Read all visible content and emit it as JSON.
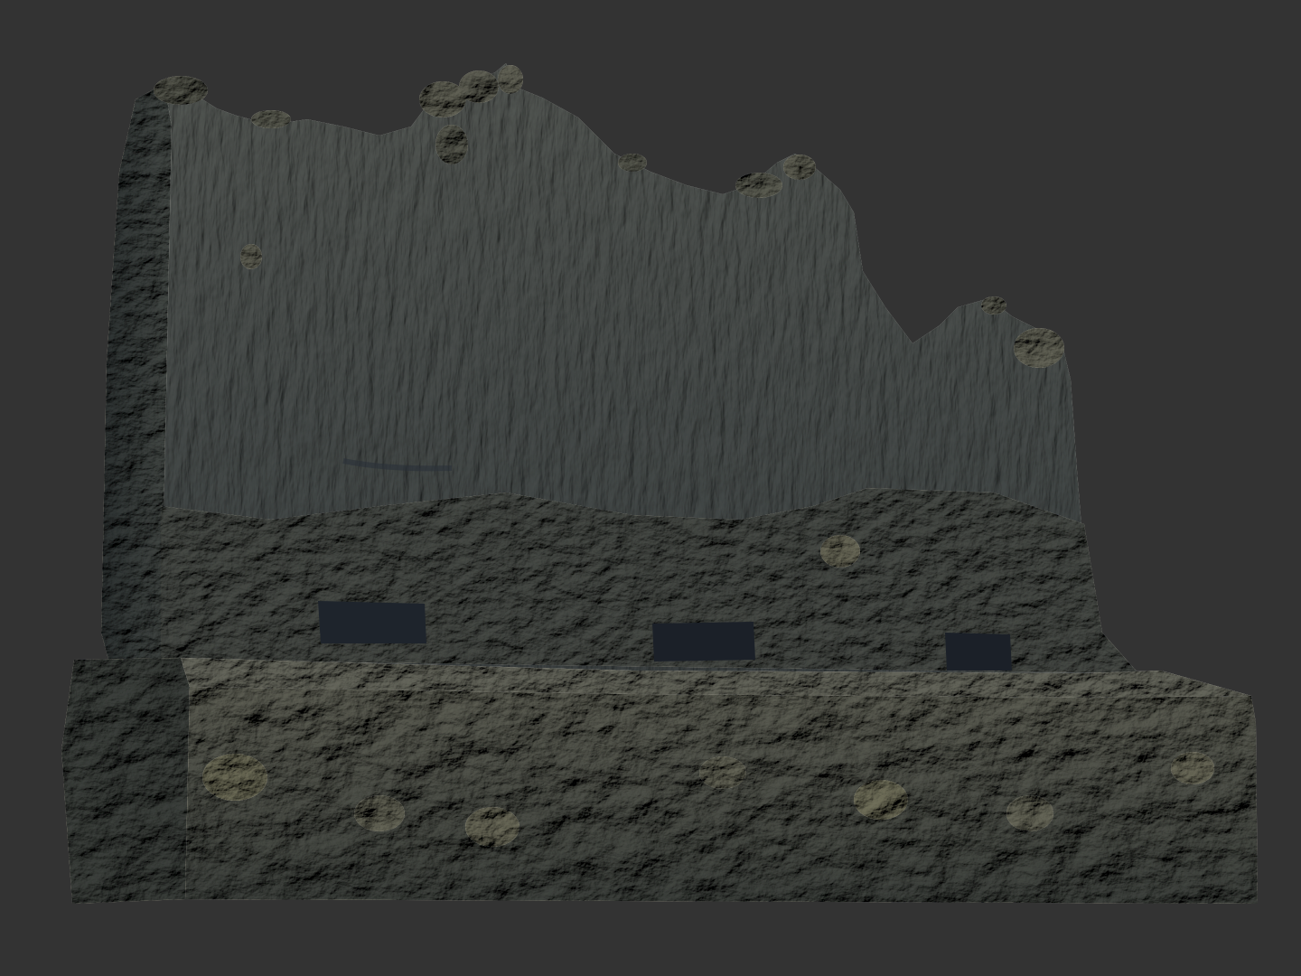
{
  "scene": {
    "subject": "ruined-stone-wall-sculpt",
    "colors": {
      "background": "#333333",
      "stone_dark": "#2c3440",
      "stone_mid": "#56606c",
      "stone_light": "#8a8f8c",
      "stone_highlight": "#c9c2a6",
      "shadow": "#1b2028"
    }
  }
}
